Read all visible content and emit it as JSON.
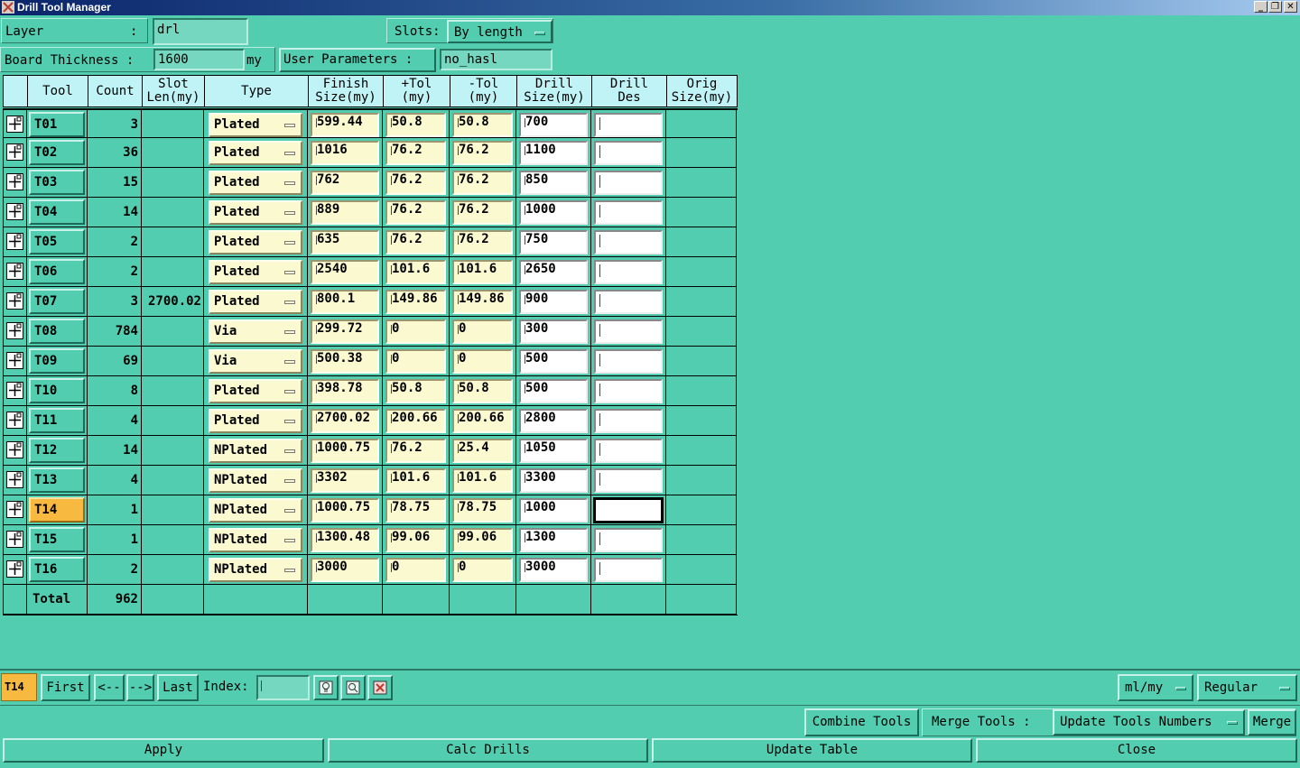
{
  "window": {
    "title": "Drill Tool Manager"
  },
  "top": {
    "layer_label": "Layer",
    "layer_colon": ":",
    "layer_value": "drl",
    "slots_label": "Slots:",
    "slots_value": "By length",
    "board_thickness_label": "Board Thickness :",
    "board_thickness_value": "1600",
    "board_thickness_unit": "my",
    "user_params_label": "User Parameters :",
    "user_params_value": "no_hasl"
  },
  "table": {
    "headers": {
      "tool": "Tool",
      "count": "Count",
      "slot1": "Slot",
      "slot2": "Len(my)",
      "type": "Type",
      "finish1": "Finish",
      "finish2": "Size(my)",
      "ptol1": "+Tol",
      "ptol2": "(my)",
      "mtol1": "-Tol",
      "mtol2": "(my)",
      "drill1": "Drill",
      "drill2": "Size(my)",
      "des1": "Drill",
      "des2": "Des",
      "orig1": "Orig",
      "orig2": "Size(my)"
    },
    "rows": [
      {
        "tool": "T01",
        "count": "3",
        "slot": "",
        "type": "Plated",
        "finish": "599.44",
        "ptol": "50.8",
        "mtol": "50.8",
        "drill": "700"
      },
      {
        "tool": "T02",
        "count": "36",
        "slot": "",
        "type": "Plated",
        "finish": "1016",
        "ptol": "76.2",
        "mtol": "76.2",
        "drill": "1100"
      },
      {
        "tool": "T03",
        "count": "15",
        "slot": "",
        "type": "Plated",
        "finish": "762",
        "ptol": "76.2",
        "mtol": "76.2",
        "drill": "850"
      },
      {
        "tool": "T04",
        "count": "14",
        "slot": "",
        "type": "Plated",
        "finish": "889",
        "ptol": "76.2",
        "mtol": "76.2",
        "drill": "1000"
      },
      {
        "tool": "T05",
        "count": "2",
        "slot": "",
        "type": "Plated",
        "finish": "635",
        "ptol": "76.2",
        "mtol": "76.2",
        "drill": "750"
      },
      {
        "tool": "T06",
        "count": "2",
        "slot": "",
        "type": "Plated",
        "finish": "2540",
        "ptol": "101.6",
        "mtol": "101.6",
        "drill": "2650"
      },
      {
        "tool": "T07",
        "count": "3",
        "slot": "2700.02",
        "type": "Plated",
        "finish": "800.1",
        "ptol": "149.86",
        "mtol": "149.86",
        "drill": "900"
      },
      {
        "tool": "T08",
        "count": "784",
        "slot": "",
        "type": "Via",
        "finish": "299.72",
        "ptol": "0",
        "mtol": "0",
        "drill": "300"
      },
      {
        "tool": "T09",
        "count": "69",
        "slot": "",
        "type": "Via",
        "finish": "500.38",
        "ptol": "0",
        "mtol": "0",
        "drill": "500"
      },
      {
        "tool": "T10",
        "count": "8",
        "slot": "",
        "type": "Plated",
        "finish": "398.78",
        "ptol": "50.8",
        "mtol": "50.8",
        "drill": "500"
      },
      {
        "tool": "T11",
        "count": "4",
        "slot": "",
        "type": "Plated",
        "finish": "2700.02",
        "ptol": "200.66",
        "mtol": "200.66",
        "drill": "2800"
      },
      {
        "tool": "T12",
        "count": "14",
        "slot": "",
        "type": "NPlated",
        "finish": "1000.75",
        "ptol": "76.2",
        "mtol": "25.4",
        "drill": "1050"
      },
      {
        "tool": "T13",
        "count": "4",
        "slot": "",
        "type": "NPlated",
        "finish": "3302",
        "ptol": "101.6",
        "mtol": "101.6",
        "drill": "3300"
      },
      {
        "tool": "T14",
        "count": "1",
        "slot": "",
        "type": "NPlated",
        "finish": "1000.75",
        "ptol": "78.75",
        "mtol": "78.75",
        "drill": "1000",
        "selected": true
      },
      {
        "tool": "T15",
        "count": "1",
        "slot": "",
        "type": "NPlated",
        "finish": "1300.48",
        "ptol": "99.06",
        "mtol": "99.06",
        "drill": "1300"
      },
      {
        "tool": "T16",
        "count": "2",
        "slot": "",
        "type": "NPlated",
        "finish": "3000",
        "ptol": "0",
        "mtol": "0",
        "drill": "3000"
      }
    ],
    "total_label": "Total",
    "total_count": "962"
  },
  "nav": {
    "current_tool": "T14",
    "first": "First",
    "prev": "<--",
    "next": "-->",
    "last": "Last",
    "index_label": "Index:",
    "index_value": "",
    "units_value": "ml/my",
    "mode_value": "Regular"
  },
  "merge": {
    "combine_tools": "Combine Tools",
    "merge_tools_label": "Merge Tools :",
    "merge_option": "Update Tools Numbers",
    "merge_button": "Merge"
  },
  "actions": {
    "apply": "Apply",
    "calc_drills": "Calc Drills",
    "update_table": "Update Table",
    "close": "Close"
  }
}
